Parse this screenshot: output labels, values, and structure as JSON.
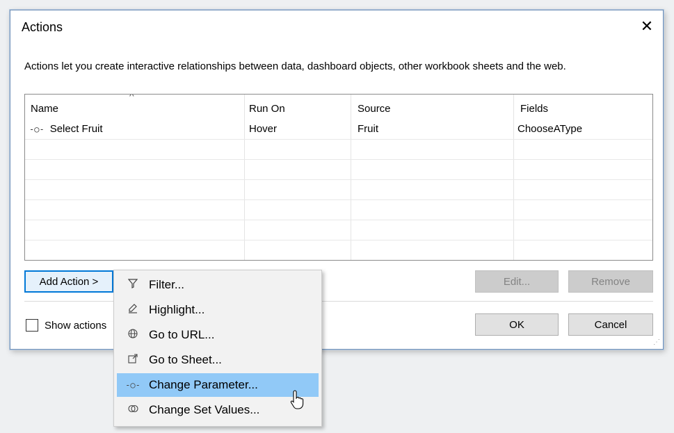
{
  "dialog": {
    "title": "Actions",
    "close_glyph": "✕",
    "description": "Actions let you create interactive relationships between data, dashboard objects, other workbook sheets and the web."
  },
  "table": {
    "columns": [
      "Name",
      "Run On",
      "Source",
      "Fields"
    ],
    "rows": [
      {
        "icon": "change-parameter-icon",
        "name": "Select Fruit",
        "run_on": "Hover",
        "source": "Fruit",
        "fields": "ChooseAType"
      }
    ]
  },
  "buttons": {
    "add_action": "Add Action >",
    "edit": "Edit...",
    "remove": "Remove",
    "ok": "OK",
    "cancel": "Cancel"
  },
  "checkbox": {
    "label": "Show actions",
    "checked": false
  },
  "menu": {
    "items": [
      {
        "icon": "filter-icon",
        "label": "Filter..."
      },
      {
        "icon": "highlight-icon",
        "label": "Highlight..."
      },
      {
        "icon": "globe-icon",
        "label": "Go to URL..."
      },
      {
        "icon": "go-to-sheet-icon",
        "label": "Go to Sheet..."
      },
      {
        "icon": "change-parameter-icon",
        "label": "Change Parameter..."
      },
      {
        "icon": "set-values-icon",
        "label": "Change Set Values..."
      }
    ],
    "highlighted_index": 4
  },
  "colors": {
    "accent": "#0078d7",
    "menu_highlight": "#91c9f7"
  }
}
